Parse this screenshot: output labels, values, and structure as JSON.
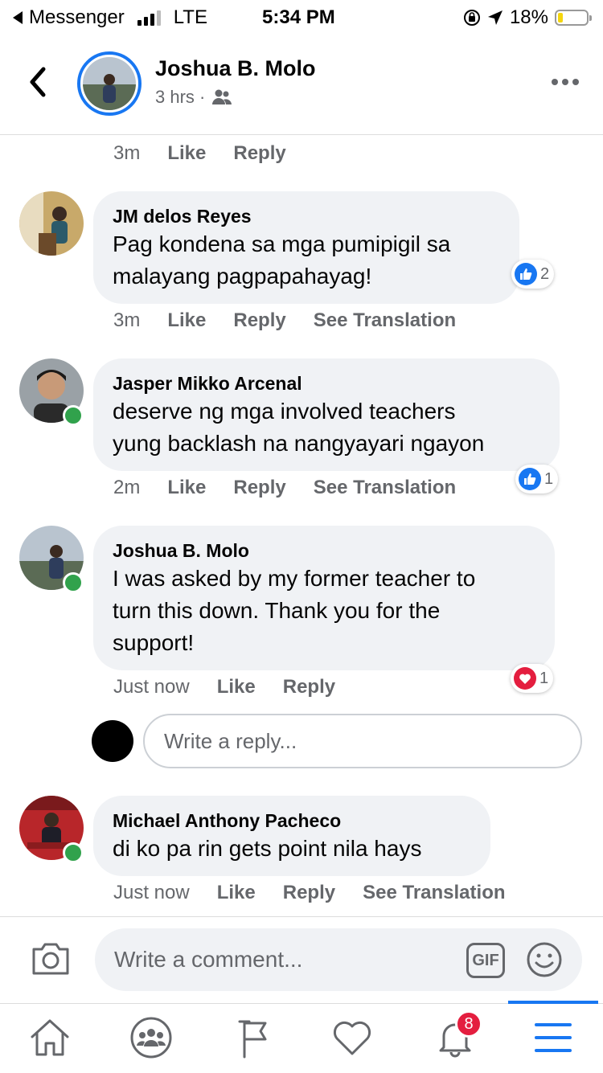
{
  "status_bar": {
    "back_app": "Messenger",
    "network": "LTE",
    "time": "5:34 PM",
    "battery": "18%",
    "battery_level": 0.18,
    "signal_bars": 3
  },
  "header": {
    "name": "Joshua B. Molo",
    "subtitle": "3 hrs ·"
  },
  "top_actions": {
    "time": "3m",
    "like": "Like",
    "reply": "Reply"
  },
  "comments": [
    {
      "name": "JM delos Reyes",
      "line1": "Pag kondena sa mga pumipigil sa",
      "line2": "malayang pagpapahayag!",
      "time": "3m",
      "like": "Like",
      "reply": "Reply",
      "translate": "See Translation",
      "reaction": "like",
      "reaction_count": "2",
      "online": false
    },
    {
      "name": "Jasper Mikko Arcenal",
      "line1": "deserve ng mga involved teachers",
      "line2": "yung backlash na nangyayari ngayon",
      "time": "2m",
      "like": "Like",
      "reply": "Reply",
      "translate": "See Translation",
      "reaction": "like",
      "reaction_count": "1",
      "online": true
    },
    {
      "name": "Joshua B. Molo",
      "line1": "I was asked by my former teacher to",
      "line2": "turn this down. Thank you for the",
      "line3": "support!",
      "time": "Just now",
      "like": "Like",
      "reply": "Reply",
      "reaction": "love",
      "reaction_count": "1",
      "online": true
    },
    {
      "name": "Michael Anthony Pacheco",
      "line1": "di ko pa rin gets point nila hays",
      "time": "Just now",
      "like": "Like",
      "reply": "Reply",
      "translate": "See Translation",
      "online": true
    }
  ],
  "reply_box": {
    "placeholder": "Write a reply..."
  },
  "composer": {
    "placeholder": "Write a comment...",
    "gif": "GIF"
  },
  "tabbar": {
    "notifications_badge": "8"
  },
  "colors": {
    "accent": "#1877f2",
    "online": "#31a24c",
    "love": "#e41e3f",
    "bubble": "#f0f2f5",
    "meta": "#65676b"
  }
}
